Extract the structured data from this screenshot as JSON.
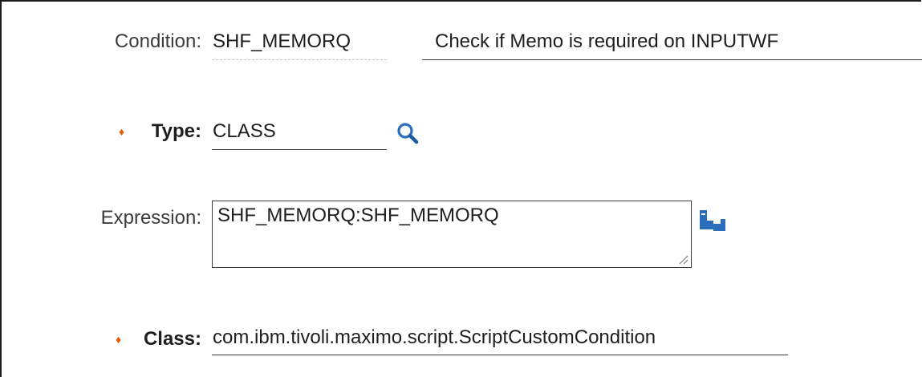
{
  "form": {
    "condition": {
      "label": "Condition:",
      "value": "SHF_MEMORQ",
      "description": "Check if Memo is required on INPUTWF"
    },
    "type": {
      "label": "Type:",
      "required_marker": "♦",
      "value": "CLASS",
      "lookup_icon": "search-icon"
    },
    "expression": {
      "label": "Expression:",
      "value": "SHF_MEMORQ:SHF_MEMORQ",
      "builder_icon": "expression-builder-icon"
    },
    "class": {
      "label": "Class:",
      "required_marker": "♦",
      "value": "com.ibm.tivoli.maximo.script.ScriptCustomCondition"
    }
  },
  "colors": {
    "required_marker": "#e8590c",
    "icon_blue": "#2a6ebb"
  }
}
